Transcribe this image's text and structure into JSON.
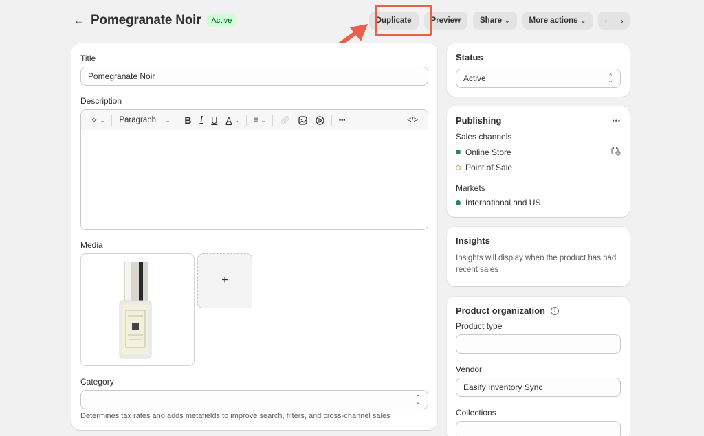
{
  "header": {
    "back_icon": "arrow-left-icon",
    "title": "Pomegranate Noir",
    "status_badge": "Active",
    "actions": {
      "duplicate": "Duplicate",
      "preview": "Preview",
      "share": "Share",
      "more_actions": "More actions"
    },
    "pager": {
      "prev": "‹",
      "next": "›"
    }
  },
  "annotation": {
    "color": "#e8604c",
    "target": "Duplicate"
  },
  "main": {
    "title_label": "Title",
    "title_value": "Pomegranate Noir",
    "description_label": "Description",
    "toolbar": {
      "ai_icon": "sparkle-icon",
      "format": "Paragraph",
      "bold": "B",
      "italic": "I",
      "underline": "U",
      "text_color": "A",
      "align_icon": "align-left-icon",
      "link_icon": "link-icon",
      "image_icon": "image-icon",
      "video_icon": "play-icon",
      "more": "•••",
      "html": "</>"
    },
    "description_value": "",
    "media_label": "Media",
    "media_add": "+",
    "category_label": "Category",
    "category_value": "",
    "category_help": "Determines tax rates and adds metafields to improve search, filters, and cross-channel sales"
  },
  "status_card": {
    "title": "Status",
    "value": "Active"
  },
  "publishing": {
    "title": "Publishing",
    "more": "•••",
    "sales_channels_label": "Sales channels",
    "channels": [
      {
        "name": "Online Store",
        "active": true
      },
      {
        "name": "Point of Sale",
        "active": false
      }
    ],
    "markets_label": "Markets",
    "markets": [
      {
        "name": "International and US",
        "active": true
      }
    ],
    "colors": {
      "active": "#29845a",
      "inactive": "#c4a04a"
    }
  },
  "insights": {
    "title": "Insights",
    "text": "Insights will display when the product has had recent sales"
  },
  "organization": {
    "title": "Product organization",
    "info": "i",
    "product_type_label": "Product type",
    "product_type_value": "",
    "vendor_label": "Vendor",
    "vendor_value": "Easify Inventory Sync",
    "collections_label": "Collections",
    "collections_value": ""
  }
}
